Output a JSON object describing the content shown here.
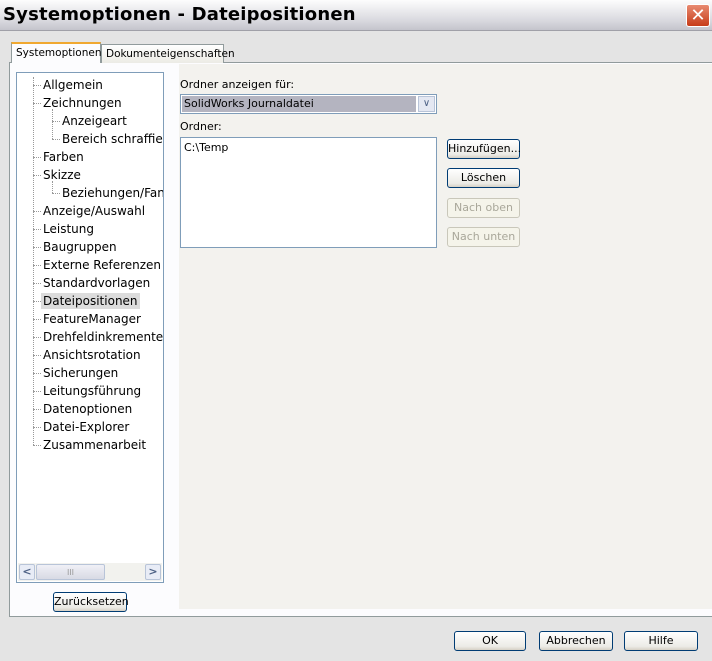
{
  "window": {
    "title": "Systemoptionen - Dateipositionen",
    "close": "✕"
  },
  "tabs": [
    {
      "label": "Systemoptionen"
    },
    {
      "label": "Dokumenteigenschaften"
    }
  ],
  "tree": {
    "items": [
      {
        "label": "Allgemein",
        "level": 1
      },
      {
        "label": "Zeichnungen",
        "level": 1
      },
      {
        "label": "Anzeigeart",
        "level": 2
      },
      {
        "label": "Bereich schraffieren",
        "level": 2
      },
      {
        "label": "Farben",
        "level": 1
      },
      {
        "label": "Skizze",
        "level": 1
      },
      {
        "label": "Beziehungen/Fang",
        "level": 2
      },
      {
        "label": "Anzeige/Auswahl",
        "level": 1
      },
      {
        "label": "Leistung",
        "level": 1
      },
      {
        "label": "Baugruppen",
        "level": 1
      },
      {
        "label": "Externe Referenzen",
        "level": 1
      },
      {
        "label": "Standardvorlagen",
        "level": 1
      },
      {
        "label": "Dateipositionen",
        "level": 1,
        "selected": true
      },
      {
        "label": "FeatureManager",
        "level": 1
      },
      {
        "label": "Drehfeldinkremente",
        "level": 1
      },
      {
        "label": "Ansichtsrotation",
        "level": 1
      },
      {
        "label": "Sicherungen",
        "level": 1
      },
      {
        "label": "Leitungsführung",
        "level": 1
      },
      {
        "label": "Datenoptionen",
        "level": 1
      },
      {
        "label": "Datei-Explorer",
        "level": 1
      },
      {
        "label": "Zusammenarbeit",
        "level": 1
      }
    ],
    "scroll_left": "<",
    "scroll_right": ">",
    "thumb": "III"
  },
  "reset_label": "Zurücksetzen",
  "main": {
    "show_for_label": "Ordner anzeigen für:",
    "show_for_value": "SolidWorks Journaldatei",
    "folders_label": "Ordner:",
    "folders": [
      "C:\\Temp"
    ],
    "add": "Hinzufügen...",
    "delete": "Löschen",
    "up": "Nach oben",
    "down": "Nach unten"
  },
  "footer": {
    "ok": "OK",
    "cancel": "Abbrechen",
    "help": "Hilfe"
  }
}
